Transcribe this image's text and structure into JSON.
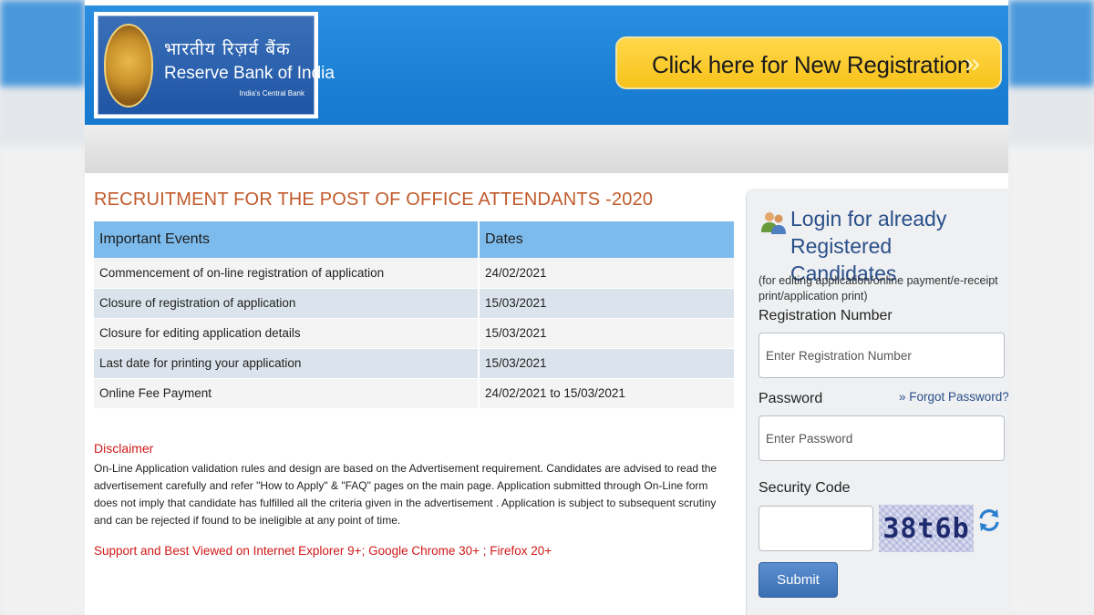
{
  "header": {
    "logo_hindi": "भारतीय रिज़र्व बैंक",
    "logo_english": "Reserve Bank of India",
    "logo_tagline": "India's Central Bank",
    "new_registration_label": "Click here for New Registration",
    "new_registration_arrow": "»"
  },
  "main": {
    "title": "RECRUITMENT FOR THE POST OF OFFICE ATTENDANTS -2020",
    "table": {
      "headers": [
        "Important Events",
        "Dates"
      ],
      "rows": [
        [
          "Commencement of on-line registration of application",
          "24/02/2021"
        ],
        [
          "Closure of registration of application",
          "15/03/2021"
        ],
        [
          "Closure for editing application details",
          "15/03/2021"
        ],
        [
          "Last date for printing your application",
          "15/03/2021"
        ],
        [
          "Online Fee Payment",
          "24/02/2021 to 15/03/2021"
        ]
      ]
    },
    "disclaimer_title": "Disclaimer",
    "disclaimer_text": "On-Line Application validation rules and design are based on the Advertisement requirement. Candidates are advised to read the advertisement carefully and refer \"How to Apply\" & \"FAQ\" pages on the main page. Application submitted through On-Line form does not imply that candidate has fulfilled all the criteria given in the advertisement . Application is subject to subsequent scrutiny and can be rejected if found to be ineligible at any point of time.",
    "support_text": "Support and Best Viewed on Internet Explorer 9+; Google Chrome 30+ ; Firefox 20+"
  },
  "login": {
    "title": "Login for already Registered Candidates",
    "note": "(for editing application/online payment/e-receipt print/application print)",
    "reg_label": "Registration Number",
    "reg_placeholder": "Enter Registration Number",
    "password_label": "Password",
    "forgot_label": "» Forgot Password?",
    "password_placeholder": "Enter Password",
    "security_label": "Security Code",
    "captcha_text": "38t6b",
    "submit_label": "Submit"
  },
  "colors": {
    "header_blue": "#1479cf",
    "button_yellow": "#f7c21a",
    "title_orange": "#c05a2a",
    "table_header": "#7dbbec",
    "warning_red": "#d01818",
    "submit_blue": "#3a6fb3"
  },
  "icons": {
    "users": "users-icon",
    "refresh": "refresh-icon",
    "seal": "rbi-seal-icon"
  }
}
